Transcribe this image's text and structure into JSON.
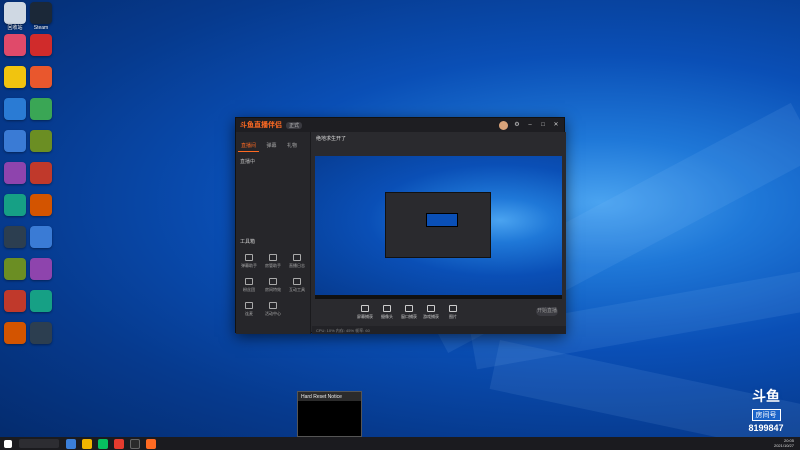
{
  "desktop": {
    "icons": [
      {
        "name": "recycle-bin-icon",
        "label": "回收站",
        "color": "#cfd8e3"
      },
      {
        "name": "app-icon-2",
        "label": "Steam",
        "color": "#1b2838"
      },
      {
        "name": "app-icon-3",
        "label": "",
        "color": "#e04a6a"
      },
      {
        "name": "app-icon-4",
        "label": "",
        "color": "#d02b2b"
      },
      {
        "name": "app-icon-5",
        "label": "",
        "color": "#f1c40f"
      },
      {
        "name": "app-icon-6",
        "label": "",
        "color": "#e9572d"
      },
      {
        "name": "app-icon-7",
        "label": "",
        "color": "#2a7bd4"
      },
      {
        "name": "app-icon-8",
        "label": "",
        "color": "#3aa655"
      }
    ]
  },
  "app": {
    "title_logo": "斗鱼直播伴侣",
    "version_chip": "正式",
    "left_tabs": [
      "直播间",
      "弹幕",
      "礼物"
    ],
    "live_label": "直播中",
    "tools_heading": "工具箱",
    "tools": [
      "弹幕助手",
      "房管助手",
      "直播日志",
      "粉丝团",
      "房间特效",
      "互动工具",
      "连麦",
      "活动中心"
    ],
    "main_title": "绝地求生开了",
    "controls": [
      "屏幕捕获",
      "摄像头",
      "窗口捕获",
      "游戏捕获",
      "图片"
    ],
    "start_button": "开始直播",
    "status_text": "CPU: 10%  内存: 45%  帧率: 60"
  },
  "notice": {
    "title": "Hard Reset Notice"
  },
  "watermark": {
    "logo": "斗鱼",
    "sub": "房间号",
    "room": "8199847"
  },
  "taskbar": {
    "time": "20:05",
    "date": "2021/10/27"
  }
}
